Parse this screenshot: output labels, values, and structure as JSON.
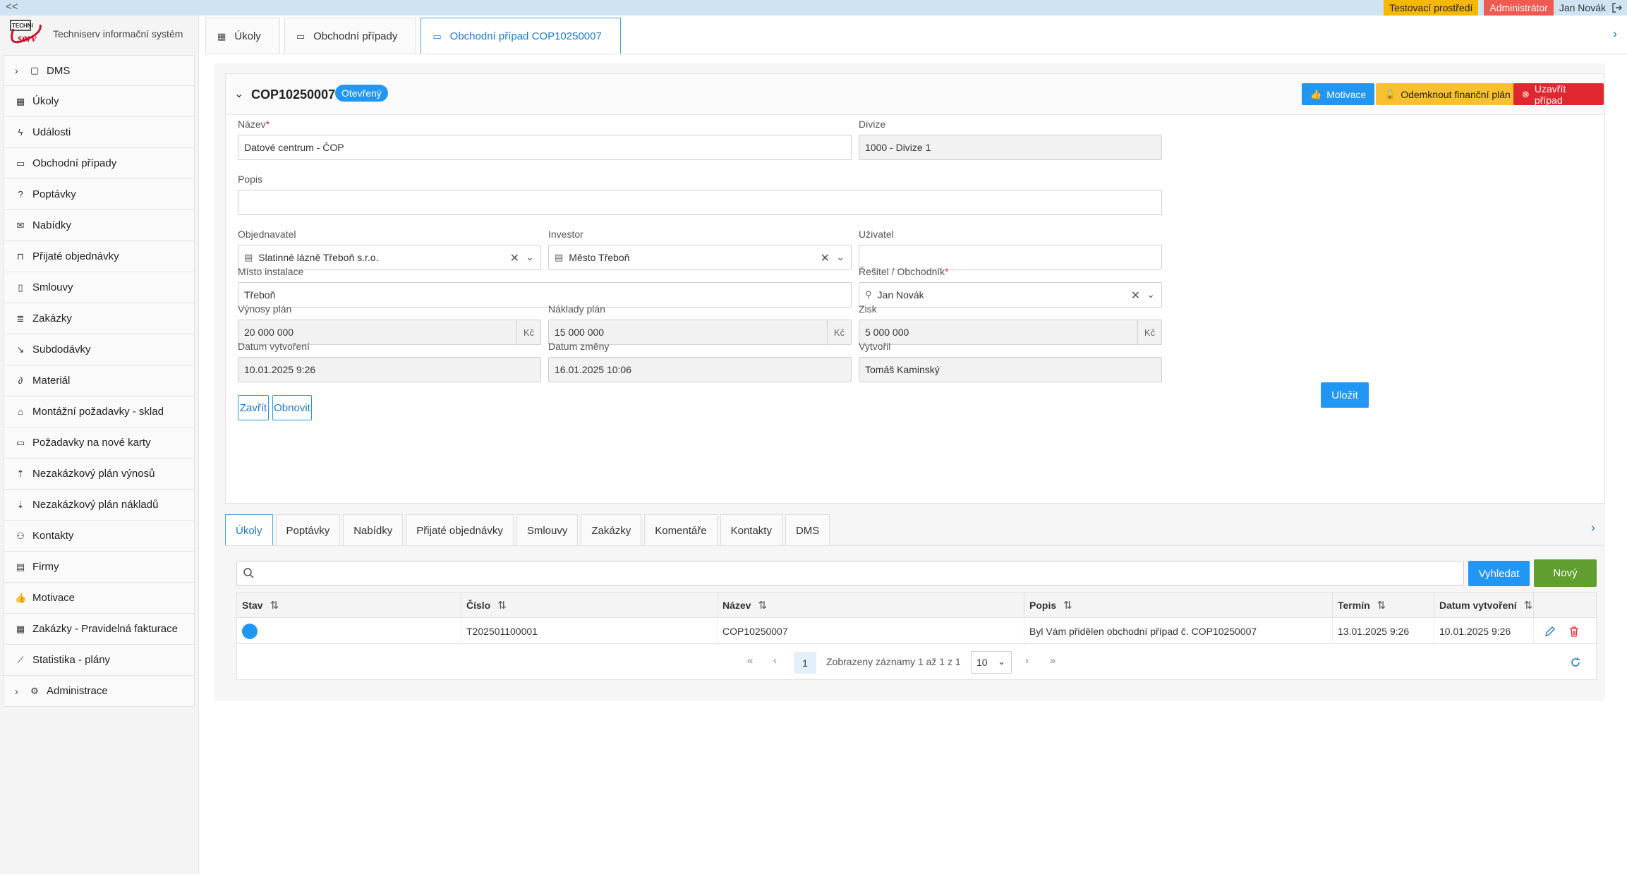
{
  "topbar": {
    "collapse": "<<",
    "env_badge": "Testovací prostředí",
    "role_badge": "Administrátor",
    "user": "Jan Novák"
  },
  "brand": {
    "logo_text": "TECHNI serv",
    "title": "Techniserv informační systém"
  },
  "sidebar": {
    "items": [
      {
        "label": "DMS",
        "icon": "box-icon",
        "expandable": true
      },
      {
        "label": "Úkoly",
        "icon": "calendar-icon"
      },
      {
        "label": "Události",
        "icon": "bolt-icon"
      },
      {
        "label": "Obchodní případy",
        "icon": "inbox-icon"
      },
      {
        "label": "Poptávky",
        "icon": "question-icon"
      },
      {
        "label": "Nabídky",
        "icon": "envelope-icon"
      },
      {
        "label": "Přijaté objednávky",
        "icon": "bag-icon"
      },
      {
        "label": "Smlouvy",
        "icon": "document-icon"
      },
      {
        "label": "Zakázky",
        "icon": "list-icon"
      },
      {
        "label": "Subdodávky",
        "icon": "arrow-down-right-icon"
      },
      {
        "label": "Materiál",
        "icon": "paperclip-icon"
      },
      {
        "label": "Montážní požadavky - sklad",
        "icon": "home-icon"
      },
      {
        "label": "Požadavky na nové karty",
        "icon": "card-icon"
      },
      {
        "label": "Nezakázkový plán výnosů",
        "icon": "sort-up-icon"
      },
      {
        "label": "Nezakázkový plán nákladů",
        "icon": "sort-down-icon"
      },
      {
        "label": "Kontakty",
        "icon": "users-icon"
      },
      {
        "label": "Firmy",
        "icon": "building-icon"
      },
      {
        "label": "Motivace",
        "icon": "thumbs-up-icon"
      },
      {
        "label": "Zakázky - Pravidelná fakturace",
        "icon": "calendar-icon"
      },
      {
        "label": "Statistika - plány",
        "icon": "chart-icon"
      },
      {
        "label": "Administrace",
        "icon": "cog-icon",
        "expandable": true
      }
    ]
  },
  "main_tabs": [
    {
      "label": "Úkoly"
    },
    {
      "label": "Obchodní případy"
    },
    {
      "label": "Obchodní případ COP10250007",
      "active": true
    }
  ],
  "case": {
    "code": "COP10250007",
    "status": "Otevřený",
    "btn_motivation": "Motivace",
    "btn_unlock": "Odemknout finanční plán",
    "btn_close": "Uzavřít případ"
  },
  "form": {
    "name_label": "Název",
    "name_value": "Datové centrum - ČOP",
    "division_label": "Divize",
    "division_value": "1000 - Divize 1",
    "desc_label": "Popis",
    "desc_value": "",
    "orderer_label": "Objednavatel",
    "orderer_value": "Slatinné lázně Třeboň s.r.o.",
    "investor_label": "Investor",
    "investor_value": "Město Třeboň",
    "user_label": "Uživatel",
    "user_value": "",
    "place_label": "Místo instalace",
    "place_value": "Třeboň",
    "solver_label": "Řešitel / Obchodník",
    "solver_value": "Jan Novák",
    "revenue_label": "Výnosy plán",
    "revenue_value": "20 000 000",
    "costs_label": "Náklady plán",
    "costs_value": "15 000 000",
    "profit_label": "Zisk",
    "profit_value": "5 000 000",
    "currency": "Kč",
    "created_label": "Datum vytvoření",
    "created_value": "10.01.2025 9:26",
    "changed_label": "Datum změny",
    "changed_value": "16.01.2025 10:06",
    "creator_label": "Vytvořil",
    "creator_value": "Tomáš  Kaminský",
    "btn_close": "Zavřít",
    "btn_refresh": "Obnovit",
    "btn_save": "Uložit"
  },
  "sub_tabs": [
    {
      "label": "Úkoly",
      "active": true
    },
    {
      "label": "Poptávky"
    },
    {
      "label": "Nabídky"
    },
    {
      "label": "Přijaté objednávky"
    },
    {
      "label": "Smlouvy"
    },
    {
      "label": "Zakázky"
    },
    {
      "label": "Komentáře"
    },
    {
      "label": "Kontakty"
    },
    {
      "label": "DMS"
    }
  ],
  "list": {
    "search_placeholder": "",
    "btn_search": "Vyhledat",
    "btn_new": "Nový",
    "columns": [
      "Stav",
      "Číslo",
      "Název",
      "Popis",
      "Termín",
      "Datum vytvoření"
    ],
    "rows": [
      {
        "status_color": "#2196f3",
        "number": "T202501100001",
        "name": "COP10250007",
        "description": "Byl Vám přidělen obchodní případ č. COP10250007",
        "deadline": "13.01.2025 9:26",
        "created": "10.01.2025 9:26"
      }
    ],
    "pager": {
      "current_page": "1",
      "info": "Zobrazeny záznamy 1 až 1 z 1",
      "page_size": "10"
    }
  },
  "colors": {
    "accent": "#2196f3",
    "warning": "#fbc02d",
    "danger": "#e0262f",
    "success": "#5f9e2f"
  }
}
